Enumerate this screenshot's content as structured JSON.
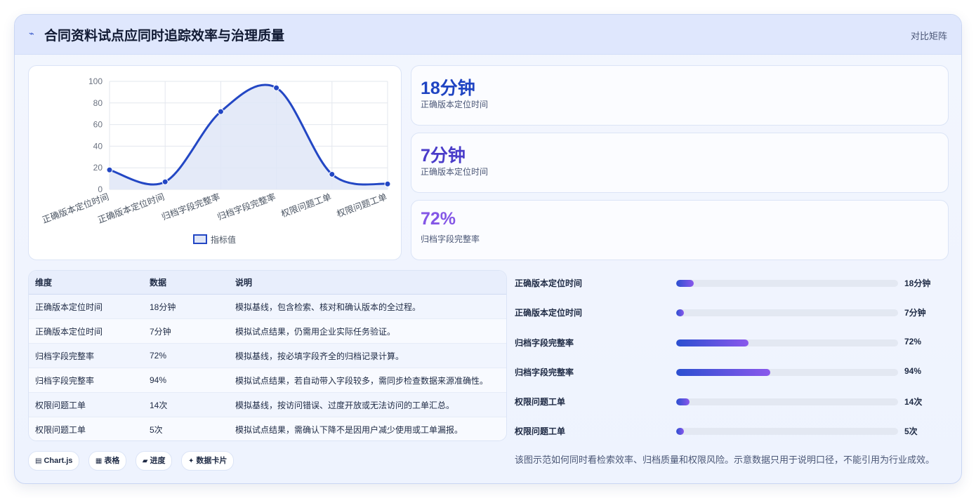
{
  "header": {
    "title": "合同资料试点应同时追踪效率与治理质量",
    "right_label": "对比矩阵"
  },
  "chart_data": {
    "type": "line",
    "categories": [
      "正确版本定位时间",
      "正确版本定位时间",
      "归档字段完整率",
      "归档字段完整率",
      "权限问题工单",
      "权限问题工单"
    ],
    "series": [
      {
        "name": "指标值",
        "values": [
          18,
          7,
          72,
          94,
          14,
          5
        ]
      }
    ],
    "ylim": [
      0,
      100
    ],
    "yticks": [
      "0",
      "20",
      "40",
      "60",
      "80",
      "100"
    ],
    "legend": "bottom",
    "grid": true,
    "colors": {
      "line": "#2347c4",
      "fill": "#dfe6f7"
    }
  },
  "stats": [
    {
      "value": "18分钟",
      "label": "正确版本定位时间",
      "color": "#1f44c2"
    },
    {
      "value": "7分钟",
      "label": "正确版本定位时间",
      "color": "#4a3cc9"
    },
    {
      "value": "72%",
      "label": "归档字段完整率",
      "color": "#8456e6"
    }
  ],
  "table": {
    "headers": [
      "维度",
      "数据",
      "说明"
    ],
    "rows": [
      [
        "正确版本定位时间",
        "18分钟",
        "模拟基线，包含检索、核对和确认版本的全过程。"
      ],
      [
        "正确版本定位时间",
        "7分钟",
        "模拟试点结果，仍需用企业实际任务验证。"
      ],
      [
        "归档字段完整率",
        "72%",
        "模拟基线，按必填字段齐全的归档记录计算。"
      ],
      [
        "归档字段完整率",
        "94%",
        "模拟试点结果，若自动带入字段较多，需同步检查数据来源准确性。"
      ],
      [
        "权限问题工单",
        "14次",
        "模拟基线，按访问错误、过度开放或无法访问的工单汇总。"
      ],
      [
        "权限问题工单",
        "5次",
        "模拟试点结果，需确认下降不是因用户减少使用或工单漏报。"
      ]
    ]
  },
  "progress": [
    {
      "label": "正确版本定位时间",
      "value": "18分钟",
      "fraction": 0.08
    },
    {
      "label": "正确版本定位时间",
      "value": "7分钟",
      "fraction": 0.035
    },
    {
      "label": "归档字段完整率",
      "value": "72%",
      "fraction": 0.325
    },
    {
      "label": "归档字段完整率",
      "value": "94%",
      "fraction": 0.425
    },
    {
      "label": "权限问题工单",
      "value": "14次",
      "fraction": 0.06
    },
    {
      "label": "权限问题工单",
      "value": "5次",
      "fraction": 0.035
    }
  ],
  "note": "该图示范如何同时看检索效率、归档质量和权限风险。示意数据只用于说明口径，不能引用为行业成效。",
  "chips": [
    {
      "icon": "▤",
      "icon_name": "chart-icon",
      "label": "Chart.js"
    },
    {
      "icon": "▦",
      "icon_name": "table-icon",
      "label": "表格"
    },
    {
      "icon": "▰",
      "icon_name": "progress-icon",
      "label": "进度"
    },
    {
      "icon": "✦",
      "icon_name": "sparkle-icon",
      "label": "数据卡片"
    }
  ]
}
